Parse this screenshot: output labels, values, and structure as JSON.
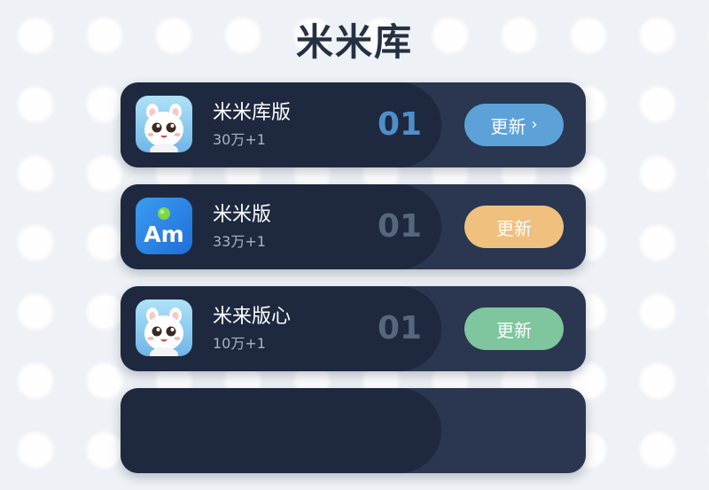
{
  "header": {
    "title": "米米库"
  },
  "apps": [
    {
      "name": "米米库版",
      "meta": "30万+1",
      "rank": "01",
      "button_label": "更新",
      "button_chevron": "›",
      "button_color": "#5ca2d9",
      "icon": "cat-mascot-icon"
    },
    {
      "name": "米米版",
      "meta": "33万+1",
      "rank": "01",
      "button_label": "更新",
      "button_color": "#efc07e",
      "icon": "am-logo-icon",
      "icon_text": "Am"
    },
    {
      "name": "米来版心",
      "meta": "10万+1",
      "rank": "01",
      "button_label": "更新",
      "button_color": "#7fc59e",
      "icon": "cat-mascot-icon"
    }
  ],
  "colors": {
    "background": "#eef1f5",
    "card": "#2b3750",
    "title": "#253044"
  }
}
